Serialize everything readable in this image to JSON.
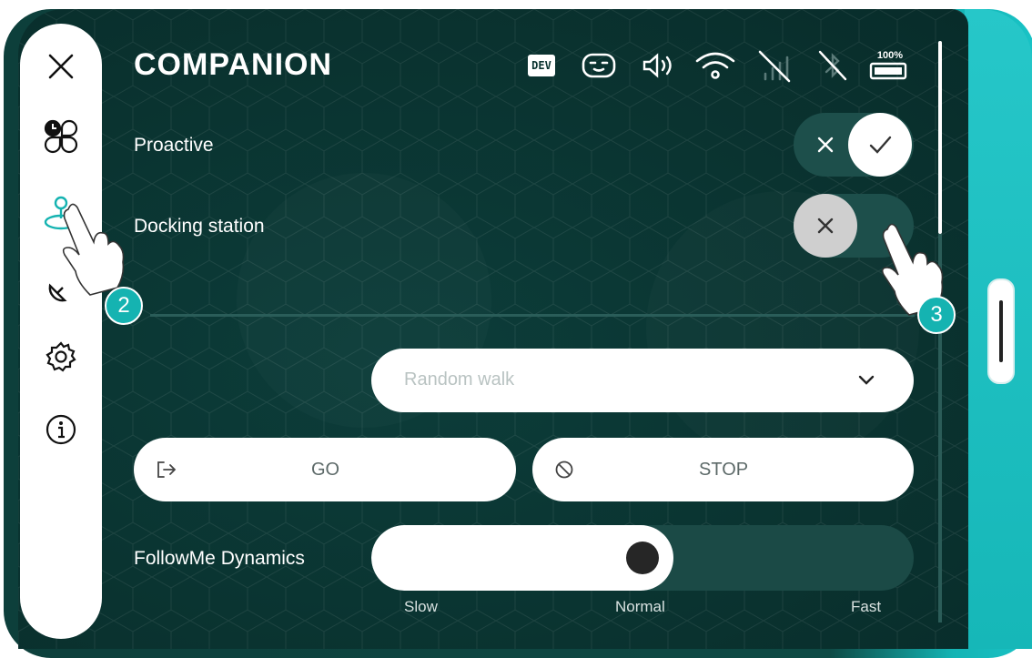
{
  "app": {
    "title": "COMPANION"
  },
  "status_bar": {
    "dev_label": "DEV",
    "battery_label": "100%"
  },
  "settings": {
    "proactive": {
      "label": "Proactive",
      "state": "on"
    },
    "docking": {
      "label": "Docking station",
      "state": "off"
    }
  },
  "mode_select": {
    "placeholder": "Random walk"
  },
  "buttons": {
    "go": "GO",
    "stop": "STOP"
  },
  "followme": {
    "label": "FollowMe Dynamics",
    "value": 0.5,
    "ticks": [
      "Slow",
      "Normal",
      "Fast"
    ]
  },
  "annotations": {
    "step_2": "2",
    "step_3": "3"
  },
  "colors": {
    "accent": "#15b3b1",
    "background": "#0a3330",
    "toggle_track": "#1d4f4b"
  },
  "icons": {
    "sidebar": [
      "close-icon",
      "apps-icon",
      "navigation-icon",
      "satellite-icon",
      "settings-icon",
      "info-icon"
    ],
    "status": [
      "dev-badge",
      "robot-face-icon",
      "speaker-icon",
      "wifi-icon",
      "cellular-off-icon",
      "bluetooth-off-icon",
      "battery-icon"
    ]
  }
}
